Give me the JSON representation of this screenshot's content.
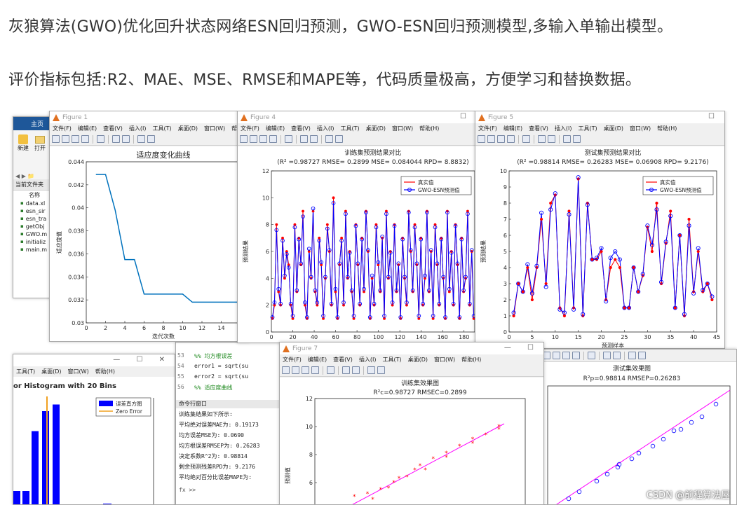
{
  "headline": {
    "line1": "灰狼算法(GWO)优化回升状态网络ESN回归预测，GWO-ESN回归预测模型,多输入单输出模型。",
    "line2": "评价指标包括:R2、MAE、MSE、RMSE和MAPE等，代码质量极高，方便学习和替换数据。"
  },
  "matlab_panel": {
    "tab_home": "主页",
    "new_label": "新建",
    "open_label": "打开",
    "current_folder": "当前文件夹",
    "name_header": "名称",
    "files": [
      "data.xl",
      "esn_sir",
      "esn_tra",
      "getObj",
      "GWO.m",
      "initializ",
      "main.m"
    ]
  },
  "fig1": {
    "title_bar": "Figure 1",
    "menu": [
      "文件(F)",
      "编辑(E)",
      "查看(V)",
      "插入(I)",
      "工具(T)",
      "桌面(D)",
      "窗口(W)",
      "帮助"
    ],
    "chart_data": {
      "type": "line",
      "title": "适应度变化曲线",
      "xlabel": "迭代次数",
      "ylabel": "适应度值",
      "x": [
        1,
        2,
        3,
        4,
        5,
        6,
        7,
        8,
        9,
        10,
        11,
        12,
        13,
        14,
        15,
        16
      ],
      "y": [
        0.0429,
        0.0429,
        0.0398,
        0.0355,
        0.0355,
        0.0325,
        0.0325,
        0.0325,
        0.0325,
        0.0325,
        0.0318,
        0.0318,
        0.0318,
        0.0318,
        0.0318,
        0.0318
      ],
      "xlim": [
        0,
        16
      ],
      "ylim": [
        0.03,
        0.044
      ],
      "xticks": [
        "0",
        "2",
        "4",
        "6",
        "8",
        "10",
        "12",
        "14"
      ],
      "yticks": [
        "0.044",
        "0.042",
        "0.04",
        "0.038",
        "0.036",
        "0.034",
        "0.032",
        "0.03"
      ],
      "color": "#0072bd"
    }
  },
  "fig4": {
    "title_bar": "Figure 4",
    "menu": [
      "文件(F)",
      "编辑(E)",
      "查看(V)",
      "插入(I)",
      "工具(T)",
      "桌面(D)",
      "窗口(W)",
      "帮助(H)"
    ],
    "chart_data": {
      "type": "line",
      "title": "训练集预测结果对比",
      "subtitle": "(R² =0.98727 RMSE= 0.2899 MSE= 0.084044 RPD= 8.8832)",
      "xlabel": "训练样本",
      "ylabel": "预测结果",
      "xlim": [
        0,
        190
      ],
      "ylim": [
        0,
        12
      ],
      "xticks": [
        "0",
        "20",
        "40",
        "60",
        "80",
        "100",
        "120",
        "140",
        "160",
        "180"
      ],
      "yticks": [
        "12",
        "10",
        "8",
        "6",
        "4",
        "2",
        "0"
      ],
      "series": [
        {
          "name": "真实值",
          "color": "#ff0000",
          "marker": "*"
        },
        {
          "name": "GWO-ESN预测值",
          "color": "#0000ff",
          "marker": "o"
        }
      ],
      "values_true": [
        1,
        2,
        8,
        3,
        2,
        7,
        4,
        6,
        5,
        2,
        1,
        8,
        3,
        7,
        5,
        9,
        2,
        1,
        6,
        4,
        9,
        3,
        2,
        7,
        5,
        1,
        4,
        8,
        6,
        2,
        10,
        3,
        1,
        5,
        7,
        2,
        9,
        4,
        6,
        3,
        1,
        8,
        5,
        2,
        7,
        3,
        9,
        6,
        1,
        4,
        2,
        8,
        5,
        3,
        7,
        1,
        9,
        4,
        6,
        2,
        8,
        3,
        5,
        1,
        7,
        4,
        2,
        9,
        6,
        3,
        8,
        5,
        1,
        7,
        2,
        4,
        9,
        3,
        6,
        1,
        8,
        5,
        2,
        7,
        4,
        1,
        9,
        3,
        6,
        2,
        8,
        5,
        1,
        7,
        3,
        4,
        9,
        2,
        6,
        1
      ],
      "values_pred": [
        1.1,
        2.2,
        7.6,
        3.2,
        2.1,
        6.8,
        4.2,
        5.8,
        4.8,
        2.1,
        1.2,
        7.8,
        3.1,
        6.9,
        5.1,
        8.6,
        2.2,
        1.1,
        6.2,
        4.1,
        9.2,
        3.1,
        2.2,
        6.8,
        5.2,
        1.2,
        4.1,
        7.7,
        6.1,
        2.1,
        9.6,
        3.2,
        1.1,
        5.1,
        6.8,
        2.2,
        8.8,
        4.1,
        5.9,
        3.1,
        1.2,
        7.9,
        5.1,
        2.1,
        6.9,
        3.2,
        8.9,
        6.1,
        1.1,
        4.2,
        2.1,
        7.8,
        5.2,
        3.1,
        7.1,
        1.2,
        8.8,
        4.1,
        5.9,
        2.2,
        7.9,
        3.1,
        5.1,
        1.1,
        6.9,
        4.1,
        2.2,
        8.9,
        6.1,
        3.1,
        7.8,
        5.1,
        1.2,
        6.9,
        2.1,
        4.2,
        8.9,
        3.1,
        6.1,
        1.2,
        7.8,
        5.1,
        2.1,
        6.9,
        4.1,
        1.1,
        8.9,
        3.2,
        5.9,
        2.1,
        7.9,
        5.1,
        1.1,
        6.9,
        3.1,
        4.1,
        8.8,
        2.1,
        6.1,
        1.2
      ]
    }
  },
  "fig5": {
    "title_bar": "Figure 5",
    "menu": [
      "文件(F)",
      "编辑(E)",
      "查看(V)",
      "插入(I)",
      "工具(T)",
      "桌面(D)",
      "窗口(W)",
      "帮助(H)"
    ],
    "chart_data": {
      "type": "line",
      "title": "测试集预测结果对比",
      "subtitle": "(R² =0.98814 RMSE= 0.26283 MSE= 0.06908 RPD= 9.2176)",
      "xlabel": "预测样本",
      "ylabel": "预测结果",
      "xlim": [
        0,
        45
      ],
      "ylim": [
        0,
        10
      ],
      "xticks": [
        "0",
        "5",
        "10",
        "15",
        "20",
        "25",
        "30",
        "35",
        "40",
        "45"
      ],
      "yticks": [
        "10",
        "9",
        "8",
        "7",
        "6",
        "5",
        "4",
        "3",
        "2",
        "1",
        "0"
      ],
      "series": [
        {
          "name": "真实值",
          "color": "#ff0000",
          "marker": "*"
        },
        {
          "name": "GWO-ESN预测值",
          "color": "#0000ff",
          "marker": "o"
        }
      ],
      "x": [
        1,
        2,
        3,
        4,
        5,
        6,
        7,
        8,
        9,
        10,
        11,
        12,
        13,
        14,
        15,
        16,
        17,
        18,
        19,
        20,
        21,
        22,
        23,
        24,
        25,
        26,
        27,
        28,
        29,
        30,
        31,
        32,
        33,
        34,
        35,
        36,
        37,
        38,
        39,
        40,
        41,
        42,
        43,
        44
      ],
      "values_true": [
        1.0,
        3.0,
        2.5,
        4.0,
        2.0,
        4.0,
        7.0,
        3.0,
        8.0,
        8.5,
        1.5,
        1.0,
        7.5,
        1.5,
        9.5,
        1.0,
        8.0,
        4.5,
        4.5,
        5.0,
        2.0,
        4.0,
        4.5,
        4.0,
        1.5,
        1.5,
        4.0,
        2.5,
        3.5,
        6.5,
        5.0,
        8.0,
        3.0,
        5.5,
        7.5,
        1.5,
        6.0,
        1.0,
        7.0,
        2.5,
        5.0,
        2.5,
        3.0,
        2.0
      ],
      "values_pred": [
        1.2,
        3.0,
        2.5,
        4.2,
        2.4,
        4.1,
        7.4,
        2.8,
        7.6,
        8.6,
        1.4,
        1.2,
        7.3,
        1.4,
        9.6,
        1.1,
        7.9,
        4.5,
        4.6,
        5.2,
        1.9,
        4.6,
        5.0,
        4.5,
        1.5,
        1.5,
        4.0,
        2.5,
        3.6,
        6.6,
        5.4,
        7.6,
        3.1,
        5.6,
        7.2,
        1.5,
        6.0,
        1.1,
        6.6,
        2.4,
        5.2,
        2.6,
        3.0,
        2.2
      ]
    }
  },
  "fig7": {
    "title_bar": "Figure 7",
    "menu": [
      "文件(F)",
      "编辑(E)",
      "查看(V)",
      "插入(I)",
      "工具(T)",
      "桌面(D)",
      "窗口(W)",
      "帮助(H)"
    ],
    "chart_data": {
      "type": "scatter",
      "title": "训练集效果图",
      "subtitle": "R²c=0.98727  RMSEC=0.2899",
      "ylabel": "预测值",
      "ylim": [
        4,
        12
      ],
      "yticks": [
        "12",
        "10",
        "8",
        "6"
      ],
      "marker_color": "#ff0000",
      "line_color": "#ff00ff"
    }
  },
  "fig8": {
    "chart_data": {
      "type": "scatter",
      "title": "测试集效果图",
      "subtitle": "R²p=0.98814  RMSEP=0.26283",
      "marker_color": "#0000ff",
      "line_color": "#ff00ff"
    }
  },
  "hist_fig": {
    "menu": [
      "工具(T)",
      "桌面(D)",
      "窗口(W)",
      "帮助(H)"
    ],
    "chart_data": {
      "type": "bar",
      "title": "or Histogram with 20 Bins",
      "legend": [
        "误差直方图",
        "Zero Error"
      ],
      "values": [
        2,
        2,
        11,
        14,
        0,
        15
      ],
      "bar_color": "#0000ff",
      "zero_color": "#f0a020"
    }
  },
  "editor": {
    "line_numbers": [
      "53",
      "54",
      "55",
      "56"
    ],
    "code_lines": [
      "%%  均方根误差",
      "error1 = sqrt(su",
      "error2 = sqrt(su",
      "%%  适应度曲线"
    ]
  },
  "console": {
    "header": "命令行窗口",
    "lines": [
      "训练集结果如下所示:",
      "平均绝对误差MAE为: 0.19173",
      "均方误差MSE为:        0.0690",
      "均方根误差RMSEP为:   0.26283",
      "决定系数R^2为:    0.98814",
      "剩余预测残差RPD为:    9.2176",
      "平均绝对百分比误差MAPE为:"
    ],
    "prompt": "fx >>"
  },
  "watermark": "CSDN @前程算法屋"
}
